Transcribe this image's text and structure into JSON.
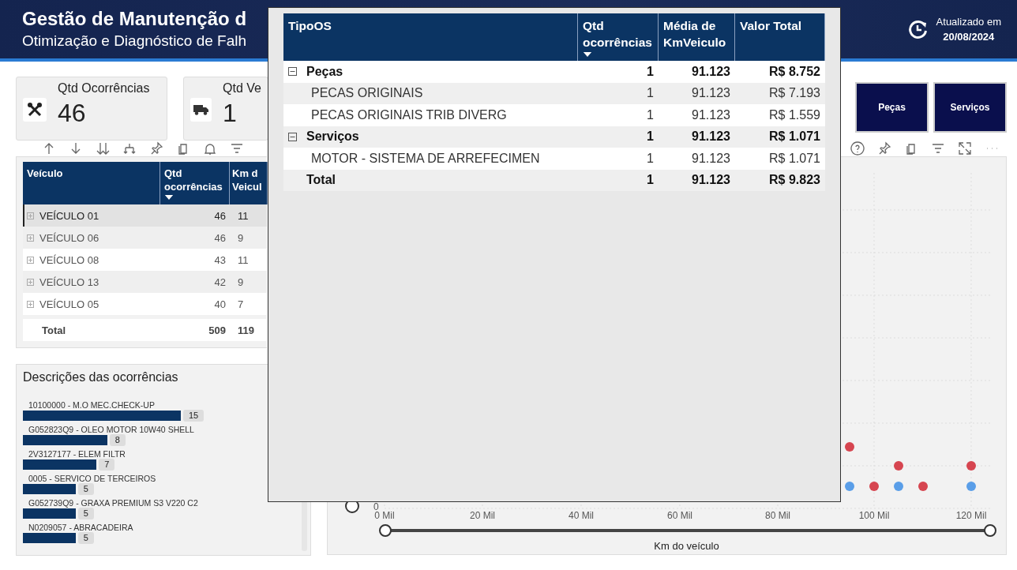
{
  "header": {
    "title": "Gestão de Manutenção d",
    "subtitle": "Otimização e Diagnóstico de Falh",
    "updated_label": "Atualizado em",
    "updated_date": "20/08/2024"
  },
  "kpis": [
    {
      "kind": "tools",
      "label": "Qtd Ocorrências",
      "value": "46"
    },
    {
      "kind": "truck",
      "label": "Qtd Ve",
      "value": "1"
    }
  ],
  "vehicle_table": {
    "columns": [
      {
        "label": "Veículo",
        "sorted": false
      },
      {
        "label": "Qtd ocorrências",
        "sorted": true
      },
      {
        "label": "Km d Veicul",
        "sorted": false
      }
    ],
    "rows": [
      {
        "vehicle": "VEÍCULO 01",
        "count": "46",
        "column_3": "11",
        "selected": true,
        "expanded": false
      },
      {
        "vehicle": "VEÍCULO 06",
        "count": "46",
        "column_3": "9",
        "selected": false,
        "expanded": false
      },
      {
        "vehicle": "VEÍCULO 08",
        "count": "43",
        "column_3": "11",
        "selected": false,
        "expanded": false
      },
      {
        "vehicle": "VEÍCULO 13",
        "count": "42",
        "column_3": "9",
        "selected": false,
        "expanded": false
      },
      {
        "vehicle": "VEÍCULO 05",
        "count": "40",
        "column_3": "7",
        "selected": false,
        "expanded": false
      }
    ],
    "total": {
      "label": "Total",
      "count": "509",
      "column_3": "119"
    }
  },
  "descriptions": {
    "chart_data": {
      "type": "bar",
      "title": "Descrições das ocorrências",
      "orientation": "horizontal",
      "data_labels": true,
      "categories": [
        "10100000 - M.O MEC.CHECK-UP",
        "G052823Q9 - OLEO MOTOR 10W40 SHELL",
        "2V3127177 - ELEM FILTR",
        "0005 - SERVICO DE TERCEIROS",
        "G052739Q9 - GRAXA PREMIUM S3 V220 C2",
        "N0209057 - ABRACADEIRA"
      ],
      "values": [
        15,
        8,
        7,
        5,
        5,
        5
      ]
    }
  },
  "filter_buttons": [
    {
      "label": "Peças"
    },
    {
      "label": "Serviços"
    }
  ],
  "chart": {
    "y_tick": "0",
    "x_ticks": [
      "0 Mil",
      "20 Mil",
      "40 Mil",
      "60 Mil",
      "80 Mil",
      "100 Mil",
      "120 Mil"
    ],
    "slider_label": "Km do veículo",
    "vertical_slider": {
      "level": 0
    },
    "range_slider": {
      "thumbs": [
        {
          "level": 0
        },
        {
          "level": 1
        }
      ]
    }
  },
  "popup_table": {
    "columns": [
      {
        "label": "TipoOS",
        "sorted": false
      },
      {
        "label": "Qtd ocorrências",
        "sorted": true
      },
      {
        "label": "Média de KmVeiculo",
        "sorted": false
      },
      {
        "label": "Valor Total",
        "sorted": false
      }
    ],
    "rows": [
      {
        "kind": "group",
        "label": "Peças",
        "expanded": true,
        "count": "1",
        "km": "91.123",
        "value": "R$ 8.752"
      },
      {
        "kind": "child",
        "label": "PECAS ORIGINAIS",
        "count": "1",
        "km": "91.123",
        "value": "R$ 7.193"
      },
      {
        "kind": "child",
        "label": "PECAS ORIGINAIS TRIB DIVERG",
        "count": "1",
        "km": "91.123",
        "value": "R$ 1.559"
      },
      {
        "kind": "group",
        "label": "Serviços",
        "expanded": true,
        "count": "1",
        "km": "91.123",
        "value": "R$ 1.071"
      },
      {
        "kind": "child",
        "label": "MOTOR - SISTEMA DE ARREFECIMEN",
        "count": "1",
        "km": "91.123",
        "value": "R$ 1.071"
      },
      {
        "kind": "total",
        "label": "Total",
        "count": "1",
        "km": "91.123",
        "value": "R$ 9.823"
      }
    ]
  }
}
